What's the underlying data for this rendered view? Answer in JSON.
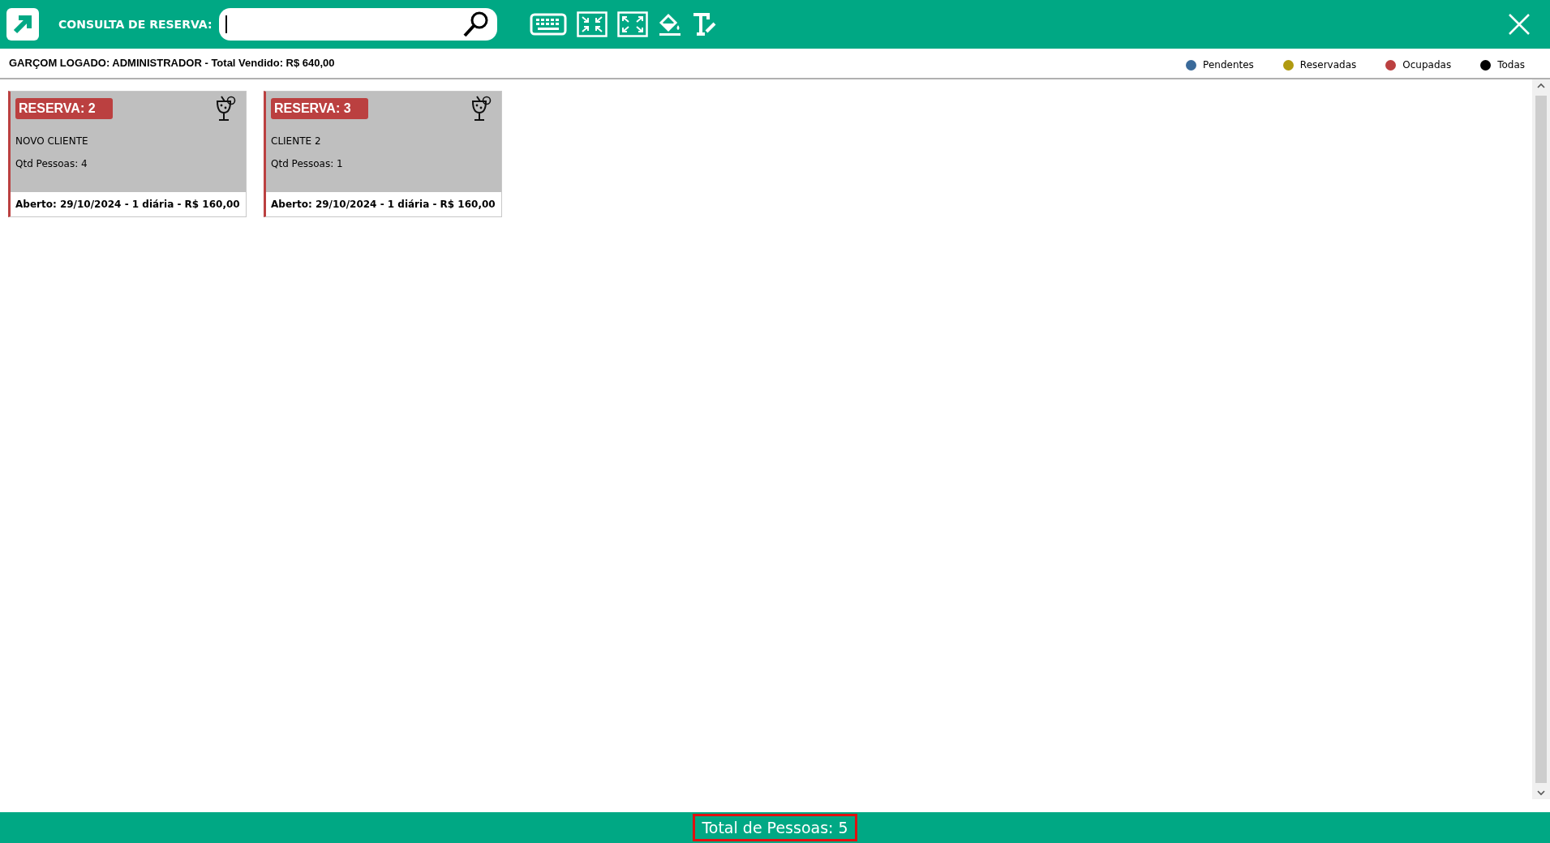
{
  "header": {
    "search_label": "CONSULTA DE RESERVA:"
  },
  "info": {
    "user_line": "GARÇOM LOGADO: ADMINISTRADOR - Total Vendido: R$ 640,00"
  },
  "legend": [
    {
      "label": "Pendentes",
      "color": "#3a6a9a"
    },
    {
      "label": "Reservadas",
      "color": "#b09a10"
    },
    {
      "label": "Ocupadas",
      "color": "#bb4040"
    },
    {
      "label": "Todas",
      "color": "#000000"
    }
  ],
  "reservations": [
    {
      "title": "RESERVA: 2",
      "client": "NOVO CLIENTE",
      "people": "Qtd Pessoas: 4",
      "footer": "Aberto: 29/10/2024 - 1 diária - R$ 160,00",
      "color": "#bb4040"
    },
    {
      "title": "RESERVA: 3",
      "client": "CLIENTE 2",
      "people": "Qtd Pessoas: 1",
      "footer": "Aberto: 29/10/2024 - 1 diária - R$ 160,00",
      "color": "#bb4040"
    }
  ],
  "status_bar": {
    "total": "Total de Pessoas: 5"
  }
}
